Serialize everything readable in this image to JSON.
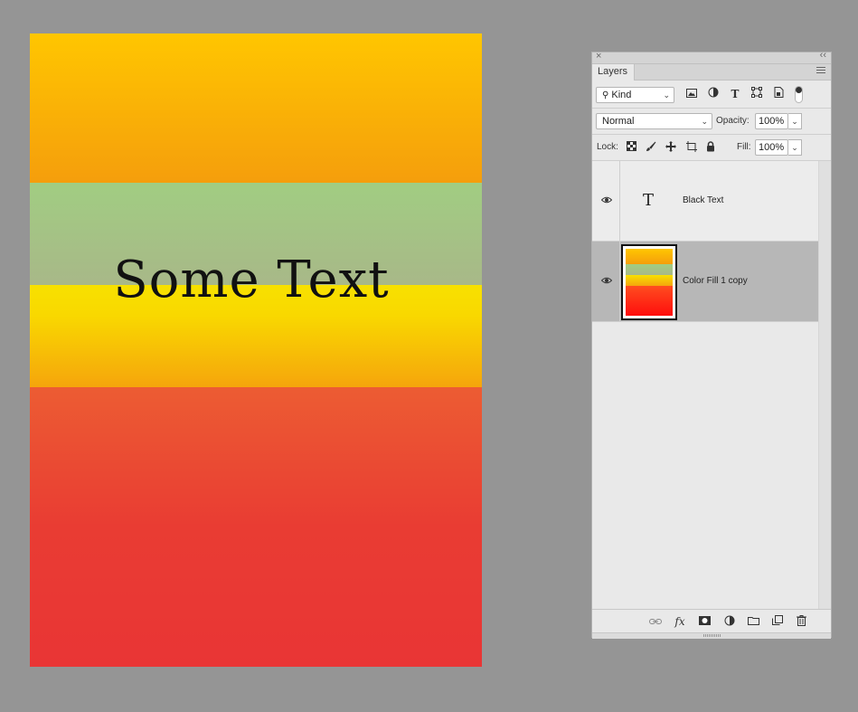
{
  "canvas": {
    "text": "Some Text",
    "colors": {
      "band_top": "#ffc600",
      "band_green": "#a1cd82",
      "band_yellow": "#f7e100",
      "band_red": "#e93535"
    }
  },
  "panel": {
    "close_glyph": "×",
    "collapse_glyph": "‹‹",
    "tab_label": "Layers",
    "filter": {
      "kind_label": "Kind",
      "icons": [
        "image-filter-icon",
        "adjustment-filter-icon",
        "type-filter-icon",
        "shape-filter-icon",
        "smart-object-filter-icon"
      ]
    },
    "blend": {
      "mode": "Normal",
      "opacity_label": "Opacity:",
      "opacity_value": "100%"
    },
    "lock": {
      "label": "Lock:",
      "fill_label": "Fill:",
      "fill_value": "100%"
    },
    "layers": [
      {
        "name": "Black Text",
        "type": "text",
        "type_glyph": "T",
        "visible": true,
        "selected": false
      },
      {
        "name": "Color Fill 1 copy",
        "type": "fill",
        "visible": true,
        "selected": true
      }
    ],
    "bottom_icons": [
      "link-layers-icon",
      "fx-icon",
      "add-mask-icon",
      "new-adjustment-icon",
      "new-group-icon",
      "new-layer-icon",
      "delete-layer-icon"
    ],
    "fx_glyph": "fx"
  }
}
